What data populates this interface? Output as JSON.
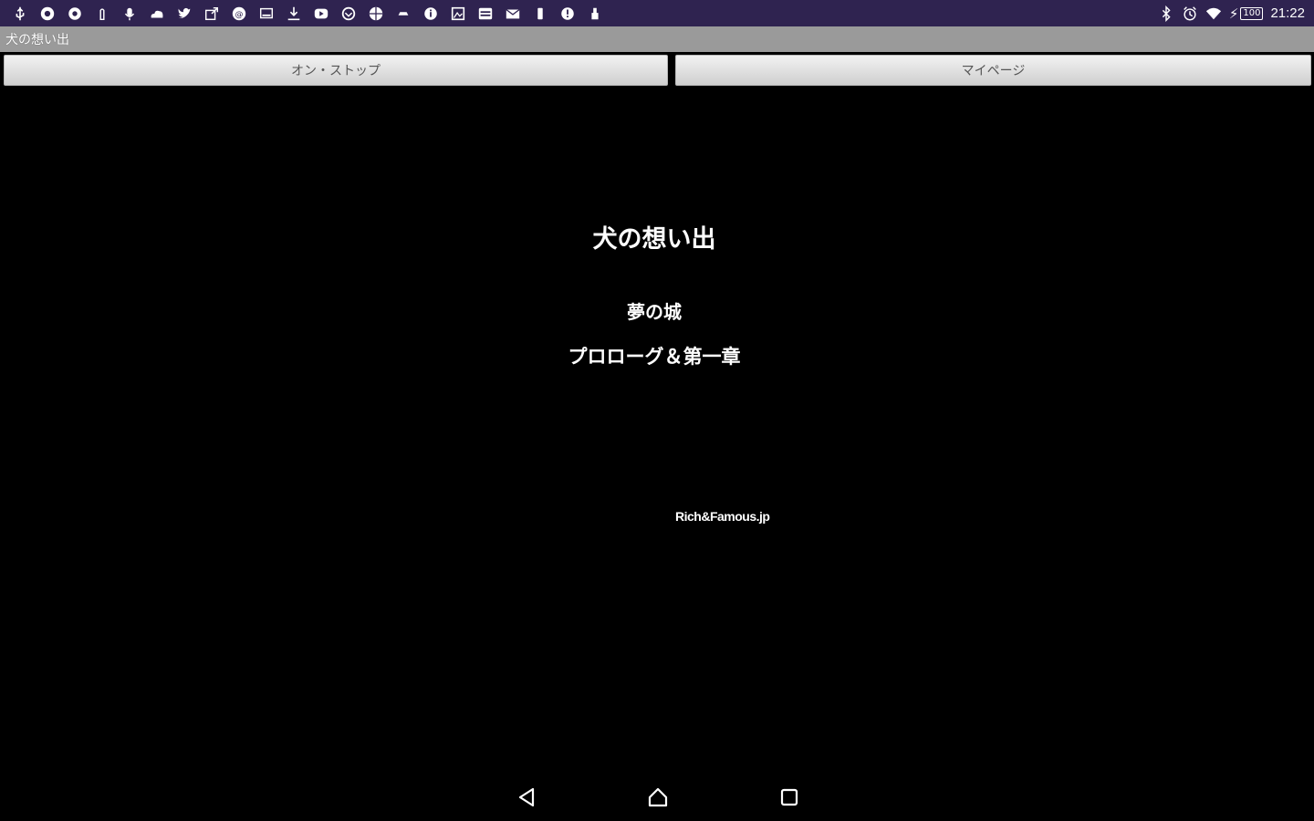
{
  "status_bar": {
    "notification_icons": [
      "usb-icon",
      "chrome-icon",
      "settings-gear-icon",
      "touch-icon",
      "voice-icon",
      "cloud-icon",
      "twitter-icon",
      "share-icon",
      "app-badge-icon",
      "screen-icon",
      "download-icon",
      "youtube-icon",
      "sync-icon",
      "globe-icon",
      "car-icon",
      "info-icon",
      "gallery-icon",
      "keyboard-icon",
      "mail-icon",
      "phone-icon",
      "alert-icon",
      "lock-icon"
    ],
    "time": "21:22",
    "battery_level": "100"
  },
  "app": {
    "title": "犬の想い出"
  },
  "tabs": {
    "on_stop_label": "オン・ストップ",
    "mypage_label": "マイページ"
  },
  "book": {
    "title": "犬の想い出",
    "subtitle": "夢の城",
    "chapter": "プロローグ＆第一章",
    "credit": "Rich&Famous.jp"
  },
  "colors": {
    "status_bar": "#2f2350",
    "title_bar": "#9a9a9a",
    "background": "#000000",
    "text": "#ffffff"
  }
}
